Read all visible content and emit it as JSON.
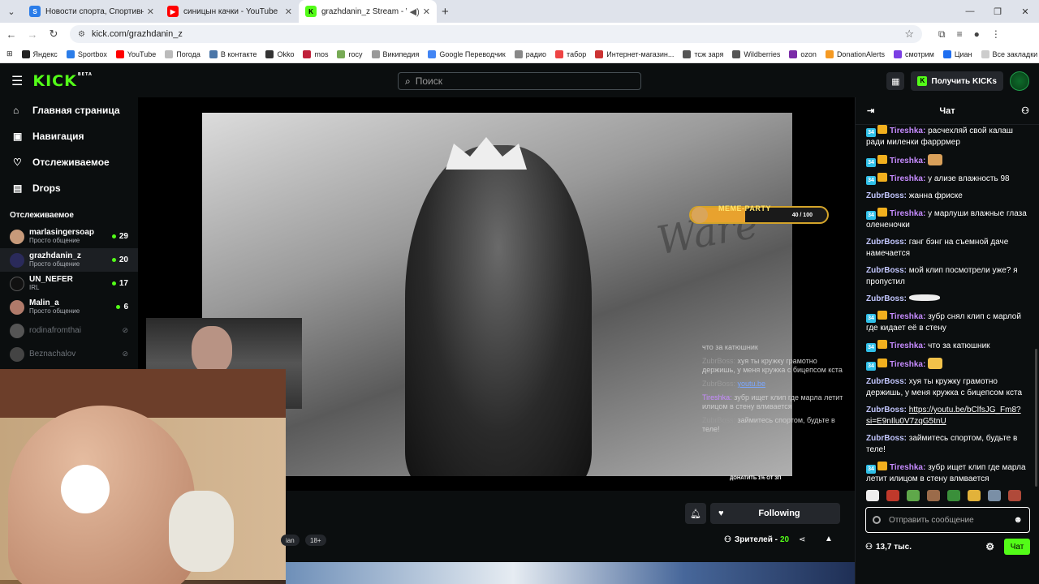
{
  "browser": {
    "tabs": [
      {
        "title": "Новости спорта, Спортивная",
        "favicon_color": "#2b7de9"
      },
      {
        "title": "синицын качки - YouTube",
        "favicon_color": "#ff0000"
      },
      {
        "title": "grazhdanin_z Stream - Wat",
        "favicon_color": "#53fc18"
      }
    ],
    "url": "kick.com/grazhdanin_z",
    "bookmarks": [
      "Яндекс",
      "Sportbox",
      "YouTube",
      "Погода",
      "В контакте",
      "Okko",
      "mos",
      "rocy",
      "Википедия",
      "Google Переводчик",
      "радио",
      "табор",
      "Интернет-магазин...",
      "тсж заря",
      "Wildberries",
      "ozon",
      "DonationAlerts",
      "смотрим",
      "Циан"
    ],
    "all_bookmarks": "Все закладки"
  },
  "header": {
    "logo": "KICK",
    "logo_badge": "BETA",
    "search_placeholder": "Поиск",
    "get_kicks": "Получить KICKs"
  },
  "sidebar": {
    "links": [
      {
        "label": "Главная страница",
        "icon": "home-icon"
      },
      {
        "label": "Навигация",
        "icon": "compass-icon"
      },
      {
        "label": "Отслеживаемое",
        "icon": "heart-icon"
      },
      {
        "label": "Drops",
        "icon": "drops-icon"
      }
    ],
    "following_title": "Отслеживаемое",
    "following": [
      {
        "name": "marlasingersoap",
        "category": "Просто общение",
        "viewers": "29",
        "live": true
      },
      {
        "name": "grazhdanin_z",
        "category": "Просто общение",
        "viewers": "20",
        "live": true,
        "selected": true
      },
      {
        "name": "UN_NEFER",
        "category": "IRL",
        "viewers": "17",
        "live": true
      },
      {
        "name": "Malin_a",
        "category": "Просто общение",
        "viewers": "6",
        "live": true
      },
      {
        "name": "rodinafromthai",
        "live": false
      },
      {
        "name": "Beznachalov",
        "live": false
      }
    ]
  },
  "player": {
    "meme_party": {
      "label": "MEME-PARTY",
      "count": "40 / 100",
      "progress": 0.4
    },
    "graffiti": "Ware",
    "overlay_chat": [
      {
        "user": "",
        "text": "что за катюшник"
      },
      {
        "user": "ZubrBoss:",
        "text": "хуя ты кружку грамотно держишь, у меня кружка с бицепсом кста"
      },
      {
        "user": "ZubrBoss:",
        "text": "youtu.be"
      },
      {
        "user": "Tireshka:",
        "text": "зубр ищет клип где марла летит илицом в стену влмвается"
      },
      {
        "user": "ZubrBoss:",
        "text": "займитесь спортом, будьте в теле!"
      }
    ],
    "donate_footer": "ДОНАТИТЬ 1% ОТ ЗП"
  },
  "stream_info": {
    "follow_label": "Following",
    "tags": [
      "ian",
      "18+"
    ],
    "viewers_label": "Зрителей -",
    "viewers_count": "20"
  },
  "chat": {
    "title": "Чат",
    "messages": [
      {
        "user": "Tireshka:",
        "sub": "34",
        "crown": true,
        "text": "расчехляй свой калаш ради миленки фарррмер",
        "style": "u1"
      },
      {
        "user": "Tireshka:",
        "sub": "34",
        "crown": true,
        "text": "",
        "emote": "face",
        "style": "u1"
      },
      {
        "user": "Tireshka:",
        "sub": "34",
        "crown": true,
        "text": "у ализе влажность 98",
        "style": "u1"
      },
      {
        "user": "ZubrBoss:",
        "text": "жанна фриске",
        "style": "u2"
      },
      {
        "user": "Tireshka:",
        "sub": "34",
        "crown": true,
        "text": "у марлуши влажные глаза олененочки",
        "style": "u1"
      },
      {
        "user": "ZubrBoss:",
        "text": "ганг бэнг на съемной даче намечается",
        "style": "u2"
      },
      {
        "user": "ZubrBoss:",
        "text": "мой клип посмотрели уже? я пропустил",
        "style": "u2"
      },
      {
        "user": "ZubrBoss:",
        "text": "",
        "emote": "ship",
        "style": "u2"
      },
      {
        "user": "Tireshka:",
        "sub": "34",
        "crown": true,
        "text": "зубр снял клип с марлой где кидает её в стену",
        "style": "u1"
      },
      {
        "user": "Tireshka:",
        "sub": "34",
        "crown": true,
        "text": "что за катюшник",
        "style": "u1"
      },
      {
        "user": "Tireshka:",
        "sub": "34",
        "crown": true,
        "text": "",
        "emote": "fist",
        "style": "u1"
      },
      {
        "user": "ZubrBoss:",
        "text": "хуя ты кружку грамотно держишь, у меня кружка с бицепсом кста",
        "style": "u2"
      },
      {
        "user": "ZubrBoss:",
        "text": "https://youtu.be/bClfsJG_Fm8?si=E9nIlu0V7zqG5tnU",
        "style": "u2",
        "link": true
      },
      {
        "user": "ZubrBoss:",
        "text": "займитесь спортом, будьте в теле!",
        "style": "u2"
      },
      {
        "user": "Tireshka:",
        "sub": "34",
        "crown": true,
        "text": "зубр ищет клип где марла летит илицом в стену влмвается",
        "style": "u1"
      }
    ],
    "emote_bar_colors": [
      "#eeeeee",
      "#c0392b",
      "#5fa84a",
      "#9b6b4a",
      "#3a8f3a",
      "#e2b23a",
      "#7a8fa6",
      "#b04a3a"
    ],
    "input_placeholder": "Отправить сообщение",
    "viewers_total": "13,7 тыс.",
    "send_label": "Чат"
  }
}
